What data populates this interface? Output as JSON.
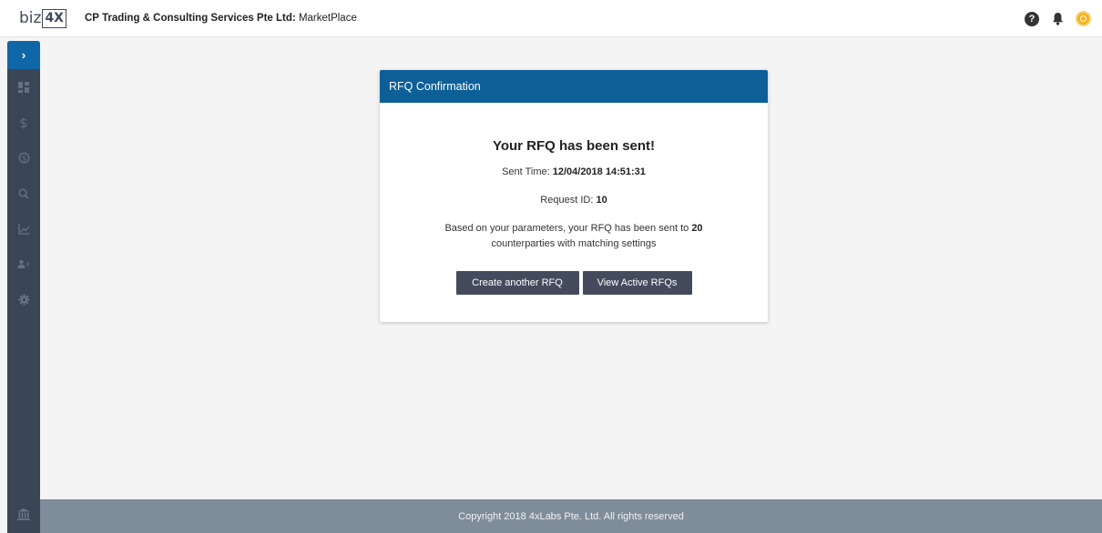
{
  "header": {
    "logo_text": "biz",
    "logo_box_text": "4X",
    "company_name": "CP Trading & Consulting Services Pte Ltd:",
    "section": "MarketPlace",
    "icons": [
      "help-icon",
      "bell-icon",
      "user-icon"
    ],
    "help_glyph": "?"
  },
  "sidebar": {
    "toggle_glyph": "›",
    "items": [
      {
        "icon": "dashboard-icon"
      },
      {
        "icon": "dollar-icon"
      },
      {
        "icon": "exchange-icon"
      },
      {
        "icon": "search-icon"
      },
      {
        "icon": "chart-icon"
      },
      {
        "icon": "users-icon"
      },
      {
        "icon": "gear-icon"
      }
    ],
    "bottom_icon": "bank-icon"
  },
  "modal": {
    "header_title": "RFQ Confirmation",
    "title": "Your RFQ has been sent!",
    "sent_time_label": "Sent Time:",
    "sent_time_value": "12/04/2018 14:51:31",
    "request_id_label": "Request ID:",
    "request_id_value": "10",
    "params_prefix": "Based on your parameters, your RFQ has been sent to",
    "params_count": "20",
    "params_suffix": "counterparties with matching settings",
    "create_button_label": "Create another RFQ",
    "view_button_label": "View Active RFQs"
  },
  "footer": {
    "copyright": "Copyright 2018 4xLabs Pte. Ltd. All rights reserved"
  },
  "colors": {
    "header_blue": "#0d5f97",
    "sidebar": "#3a4556",
    "sidebar_toggle": "#0f67a8",
    "button": "#434b5d",
    "footer": "#7f8c9a",
    "user_badge": "#f6b21a"
  }
}
